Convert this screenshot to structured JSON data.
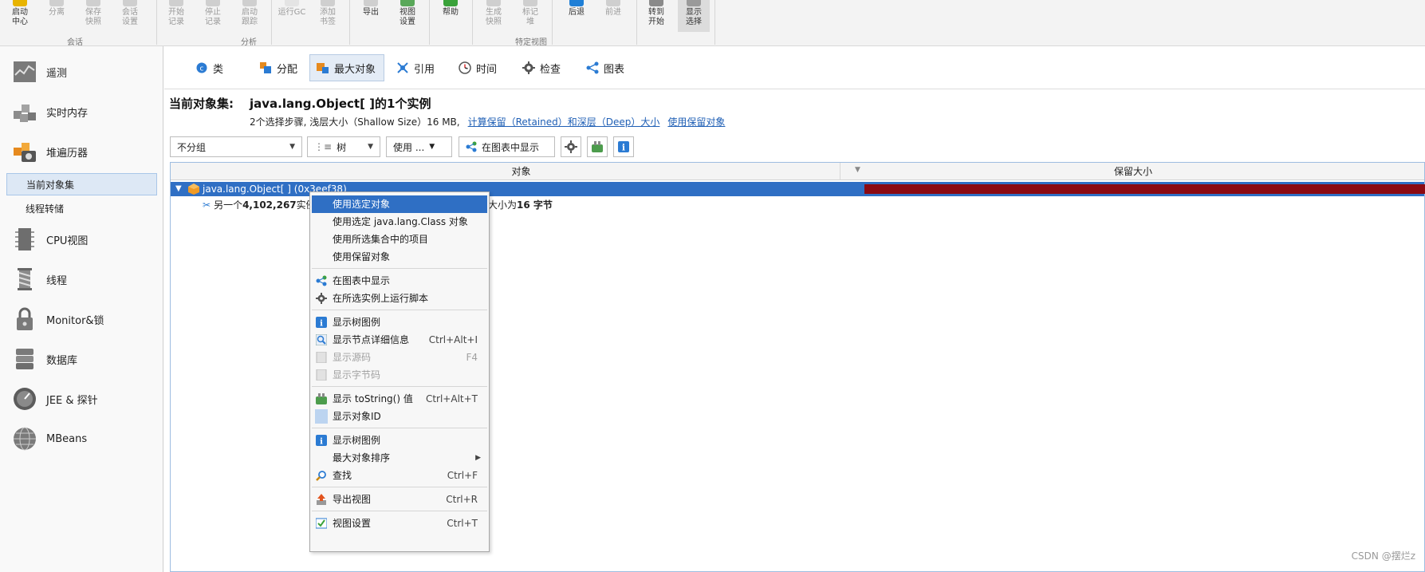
{
  "ribbon": {
    "buttons": [
      {
        "label": "启动\n中心",
        "enabled": true
      },
      {
        "label": "分离",
        "enabled": false
      },
      {
        "label": "保存\n快照",
        "enabled": false
      },
      {
        "label": "会话\n设置",
        "enabled": false
      },
      {
        "label": "开始\n记录",
        "enabled": false
      },
      {
        "label": "停止\n记录",
        "enabled": false
      },
      {
        "label": "启动\n跟踪",
        "enabled": false
      },
      {
        "label": "运行GC",
        "enabled": false
      },
      {
        "label": "添加\n书签",
        "enabled": false
      },
      {
        "label": "导出",
        "enabled": true
      },
      {
        "label": "视图\n设置",
        "enabled": true
      },
      {
        "label": "帮助",
        "enabled": true
      },
      {
        "label": "生成\n快照",
        "enabled": false
      },
      {
        "label": "标记\n堆",
        "enabled": false
      },
      {
        "label": "后退",
        "enabled": true
      },
      {
        "label": "前进",
        "enabled": false
      },
      {
        "label": "转到\n开始",
        "enabled": true
      },
      {
        "label": "显示\n选择",
        "enabled": true
      }
    ],
    "groups": {
      "session": "会话",
      "profiling": "分析",
      "view_specific": "特定视图"
    }
  },
  "sidebar": {
    "items": [
      {
        "label": "遥测"
      },
      {
        "label": "实时内存"
      },
      {
        "label": "堆遍历器"
      },
      {
        "label": "CPU视图"
      },
      {
        "label": "线程"
      },
      {
        "label": "Monitor&锁"
      },
      {
        "label": "数据库"
      },
      {
        "label": "JEE & 探针"
      },
      {
        "label": "MBeans"
      }
    ],
    "subitems": [
      {
        "label": "当前对象集",
        "selected": true
      },
      {
        "label": "线程转储",
        "selected": false
      }
    ]
  },
  "tabs": [
    {
      "label": "类",
      "active": false
    },
    {
      "label": "分配",
      "active": false
    },
    {
      "label": "最大对象",
      "active": true
    },
    {
      "label": "引用",
      "active": false
    },
    {
      "label": "时间",
      "active": false
    },
    {
      "label": "检查",
      "active": false
    },
    {
      "label": "图表",
      "active": false
    }
  ],
  "header": {
    "label": "当前对象集:",
    "title": "java.lang.Object[ ]的1个实例",
    "subtitle": "2个选择步骤, 浅层大小（Shallow Size）16 MB,",
    "link_retained": "计算保留（Retained）和深层（Deep）大小",
    "link_use_retained": "使用保留对象"
  },
  "controls": {
    "grouping": "不分组",
    "view_mode": "树",
    "use": "使用 ...",
    "show_in_graph": "在图表中显示"
  },
  "table": {
    "columns": {
      "object": "对象",
      "retained": "保留大小"
    },
    "selected_row": "java.lang.Object[ ] (0x3eef38)",
    "row2_prefix": "另一个",
    "row2_bold": "4,102,267",
    "row2_text": "实例",
    "row2_tail_prefix": "大小为",
    "row2_tail_bold": "16 字节"
  },
  "context_menu": {
    "items": [
      {
        "label": "使用选定对象",
        "shortcut": "",
        "icon": "",
        "highlighted": true,
        "disabled": false
      },
      {
        "label": "使用选定 java.lang.Class 对象",
        "shortcut": "",
        "icon": "",
        "highlighted": false,
        "disabled": false
      },
      {
        "label": "使用所选集合中的项目",
        "shortcut": "",
        "icon": "",
        "highlighted": false,
        "disabled": false
      },
      {
        "label": "使用保留对象",
        "shortcut": "",
        "icon": "",
        "highlighted": false,
        "disabled": false
      },
      {
        "label": "在图表中显示",
        "shortcut": "",
        "icon": "graph-icon",
        "highlighted": false,
        "disabled": false
      },
      {
        "label": "在所选实例上运行脚本",
        "shortcut": "",
        "icon": "gear-icon",
        "highlighted": false,
        "disabled": false
      },
      {
        "label": "显示树图例",
        "shortcut": "",
        "icon": "info-icon",
        "highlighted": false,
        "disabled": false
      },
      {
        "label": "显示节点详细信息",
        "shortcut": "Ctrl+Alt+I",
        "icon": "magnifier-icon",
        "highlighted": false,
        "disabled": false
      },
      {
        "label": "显示源码",
        "shortcut": "F4",
        "icon": "source-icon",
        "highlighted": false,
        "disabled": true
      },
      {
        "label": "显示字节码",
        "shortcut": "",
        "icon": "bytecode-icon",
        "highlighted": false,
        "disabled": true
      },
      {
        "label": "显示 toString() 值",
        "shortcut": "Ctrl+Alt+T",
        "icon": "tostring-icon",
        "highlighted": false,
        "disabled": false
      },
      {
        "label": "显示对象ID",
        "shortcut": "",
        "icon": "id-icon",
        "highlighted": false,
        "disabled": false
      },
      {
        "label": "显示树图例",
        "shortcut": "",
        "icon": "info-icon",
        "highlighted": false,
        "disabled": false
      },
      {
        "label": "最大对象排序",
        "shortcut": "",
        "icon": "",
        "highlighted": false,
        "disabled": false,
        "submenu": true
      },
      {
        "label": "查找",
        "shortcut": "Ctrl+F",
        "icon": "search-icon",
        "highlighted": false,
        "disabled": false
      },
      {
        "label": "导出视图",
        "shortcut": "Ctrl+R",
        "icon": "export-icon",
        "highlighted": false,
        "disabled": false
      },
      {
        "label": "视图设置",
        "shortcut": "Ctrl+T",
        "icon": "view-settings-icon",
        "highlighted": false,
        "disabled": false
      }
    ]
  },
  "watermark": "CSDN @摆烂z",
  "colors": {
    "selection": "#2f6fc4",
    "retained_bar": "#8b0a12",
    "link": "#1f5fb5",
    "active_tab": "#e4ecf6"
  }
}
